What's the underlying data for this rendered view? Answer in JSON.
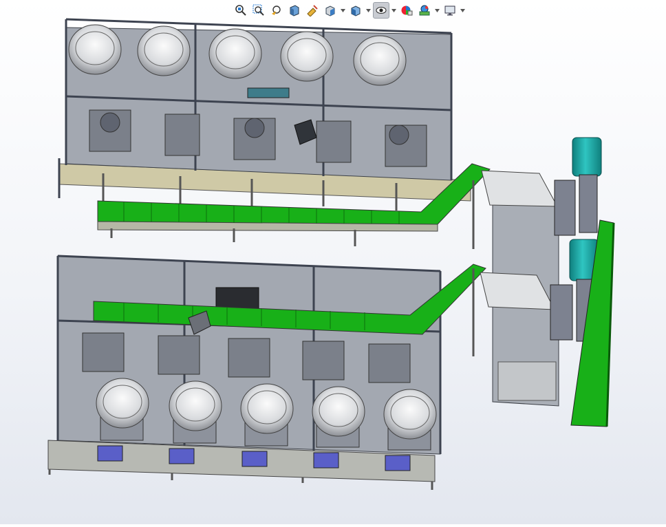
{
  "app": {
    "type": "3d-cad-viewport",
    "background": "#eef1f6"
  },
  "toolbar": {
    "items": [
      {
        "icon": "zoom-to-fit-icon",
        "dropdown": false
      },
      {
        "icon": "zoom-to-area-icon",
        "dropdown": false
      },
      {
        "icon": "previous-view-icon",
        "dropdown": false
      },
      {
        "icon": "section-view-icon",
        "dropdown": false
      },
      {
        "icon": "dynamic-annotation-icon",
        "dropdown": false
      },
      {
        "icon": "view-orientation-icon",
        "dropdown": true
      },
      {
        "icon": "display-style-icon",
        "dropdown": true
      },
      {
        "icon": "hide-show-items-icon",
        "dropdown": true,
        "active": true
      },
      {
        "icon": "edit-appearance-icon",
        "dropdown": false
      },
      {
        "icon": "apply-scene-icon",
        "dropdown": true
      },
      {
        "icon": "view-settings-icon",
        "dropdown": true
      }
    ]
  },
  "model": {
    "description_colors": {
      "frame": "#5b6270",
      "panel": "#9aa0aa",
      "conveyor": "#1fb31f",
      "tank": "#1aa9a6",
      "base": "#c8c09a",
      "bin": "#5a5fc8",
      "hmi": "#2d2f33"
    }
  }
}
